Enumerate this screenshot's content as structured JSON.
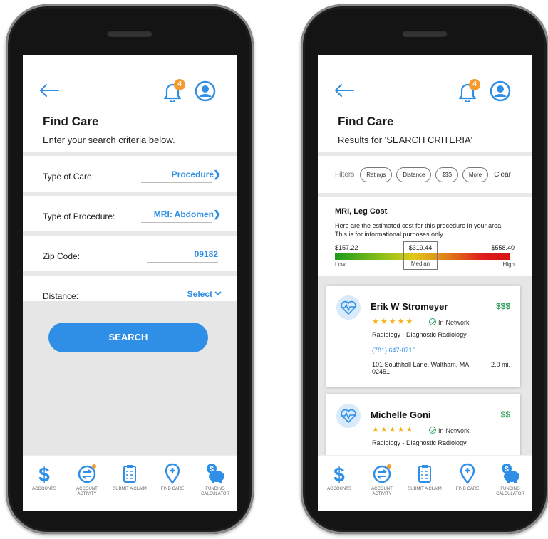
{
  "left_screen": {
    "notification_count": "4",
    "title": "Find Care",
    "subtitle": "Enter your search criteria below.",
    "fields": [
      {
        "label": "Type of Care:",
        "value": "Procedure"
      },
      {
        "label": "Type of Procedure:",
        "value": "MRI: Abdomen"
      },
      {
        "label": "Zip Code:",
        "value": "09182"
      },
      {
        "label": "Distance:",
        "value": "Select"
      }
    ],
    "search_label": "SEARCH"
  },
  "right_screen": {
    "notification_count": "4",
    "title": "Find Care",
    "subtitle": "Results for 'SEARCH CRITERIA'",
    "filters_label": "Filters",
    "chips": [
      "Ratings",
      "Distance",
      "$$$",
      "More"
    ],
    "clear_label": "Clear",
    "cost": {
      "title": "MRI, Leg Cost",
      "description": "Here are the estimated cost for this procedure in your area. This is for informational purposes only.",
      "low_value": "$157.22",
      "median_value": "$319.44",
      "high_value": "$558.40",
      "low_label": "Low",
      "median_label": "Median",
      "high_label": "High"
    },
    "results": [
      {
        "name": "Erik W Stromeyer",
        "price": "$$$",
        "stars": "★★★★★",
        "network": "In-Network",
        "specialty": "Radiology - Diagnostic Radiology",
        "phone": "(781) 647-0716",
        "address": "101 Southhall Lane, Waltham, MA 02451",
        "distance": "2.0 mi."
      },
      {
        "name": "Michelle Goni",
        "price": "$$",
        "stars": "★★★★★",
        "network": "In-Network",
        "specialty": "Radiology - Diagnostic Radiology"
      }
    ]
  },
  "nav": [
    {
      "label": "ACCOUNTS",
      "icon": "dollar-icon"
    },
    {
      "label": "ACCOUNT ACTIVITY",
      "icon": "account-activity-icon"
    },
    {
      "label": "SUBMIT A CLAIM",
      "icon": "clipboard-icon"
    },
    {
      "label": "FIND CARE",
      "icon": "location-pin-icon"
    },
    {
      "label": "FUNDING CALCULATOR",
      "icon": "piggy-bank-icon"
    }
  ],
  "colors": {
    "accent": "#2f8fe6",
    "badge": "#f59a2f",
    "price_green": "#2fa05a",
    "stars": "#f2b51c"
  }
}
